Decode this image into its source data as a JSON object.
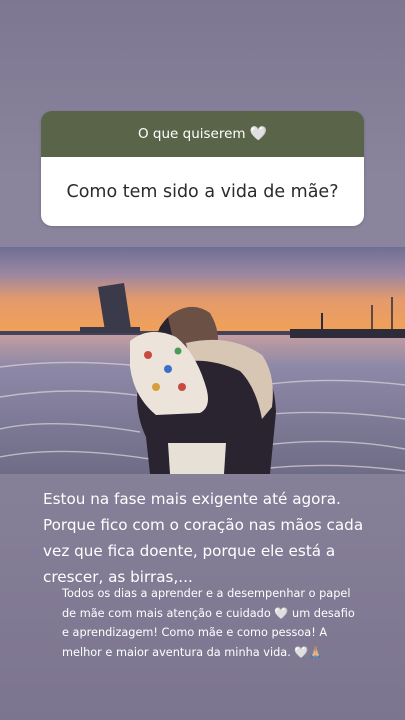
{
  "question_sticker": {
    "prompt": "O que quiserem",
    "prompt_emoji": "🤍",
    "question": "Como tem sido a vida de mãe?"
  },
  "photo": {
    "description_icon": "sunset-beach-photo"
  },
  "caption_main": "Estou na fase mais exigente até agora. Porque fico com o coração nas mãos cada vez que fica doente, porque ele está a crescer, as birras,...",
  "caption_secondary": {
    "part1": "Todos os dias a aprender e a desempenhar o papel de mãe com mais  atenção e cuidado ",
    "emoji1": "🤍",
    "part2": " um desafio e aprendizagem! Como mãe e como pessoa! A melhor e maior aventura da minha vida. ",
    "emoji2": "🤍🙏🏼"
  },
  "colors": {
    "background_top": "#7d7792",
    "background_bottom": "#7c7590",
    "sticker_header": "#5a6448",
    "sticker_body": "#ffffff",
    "caption_text": "#ffffff"
  }
}
